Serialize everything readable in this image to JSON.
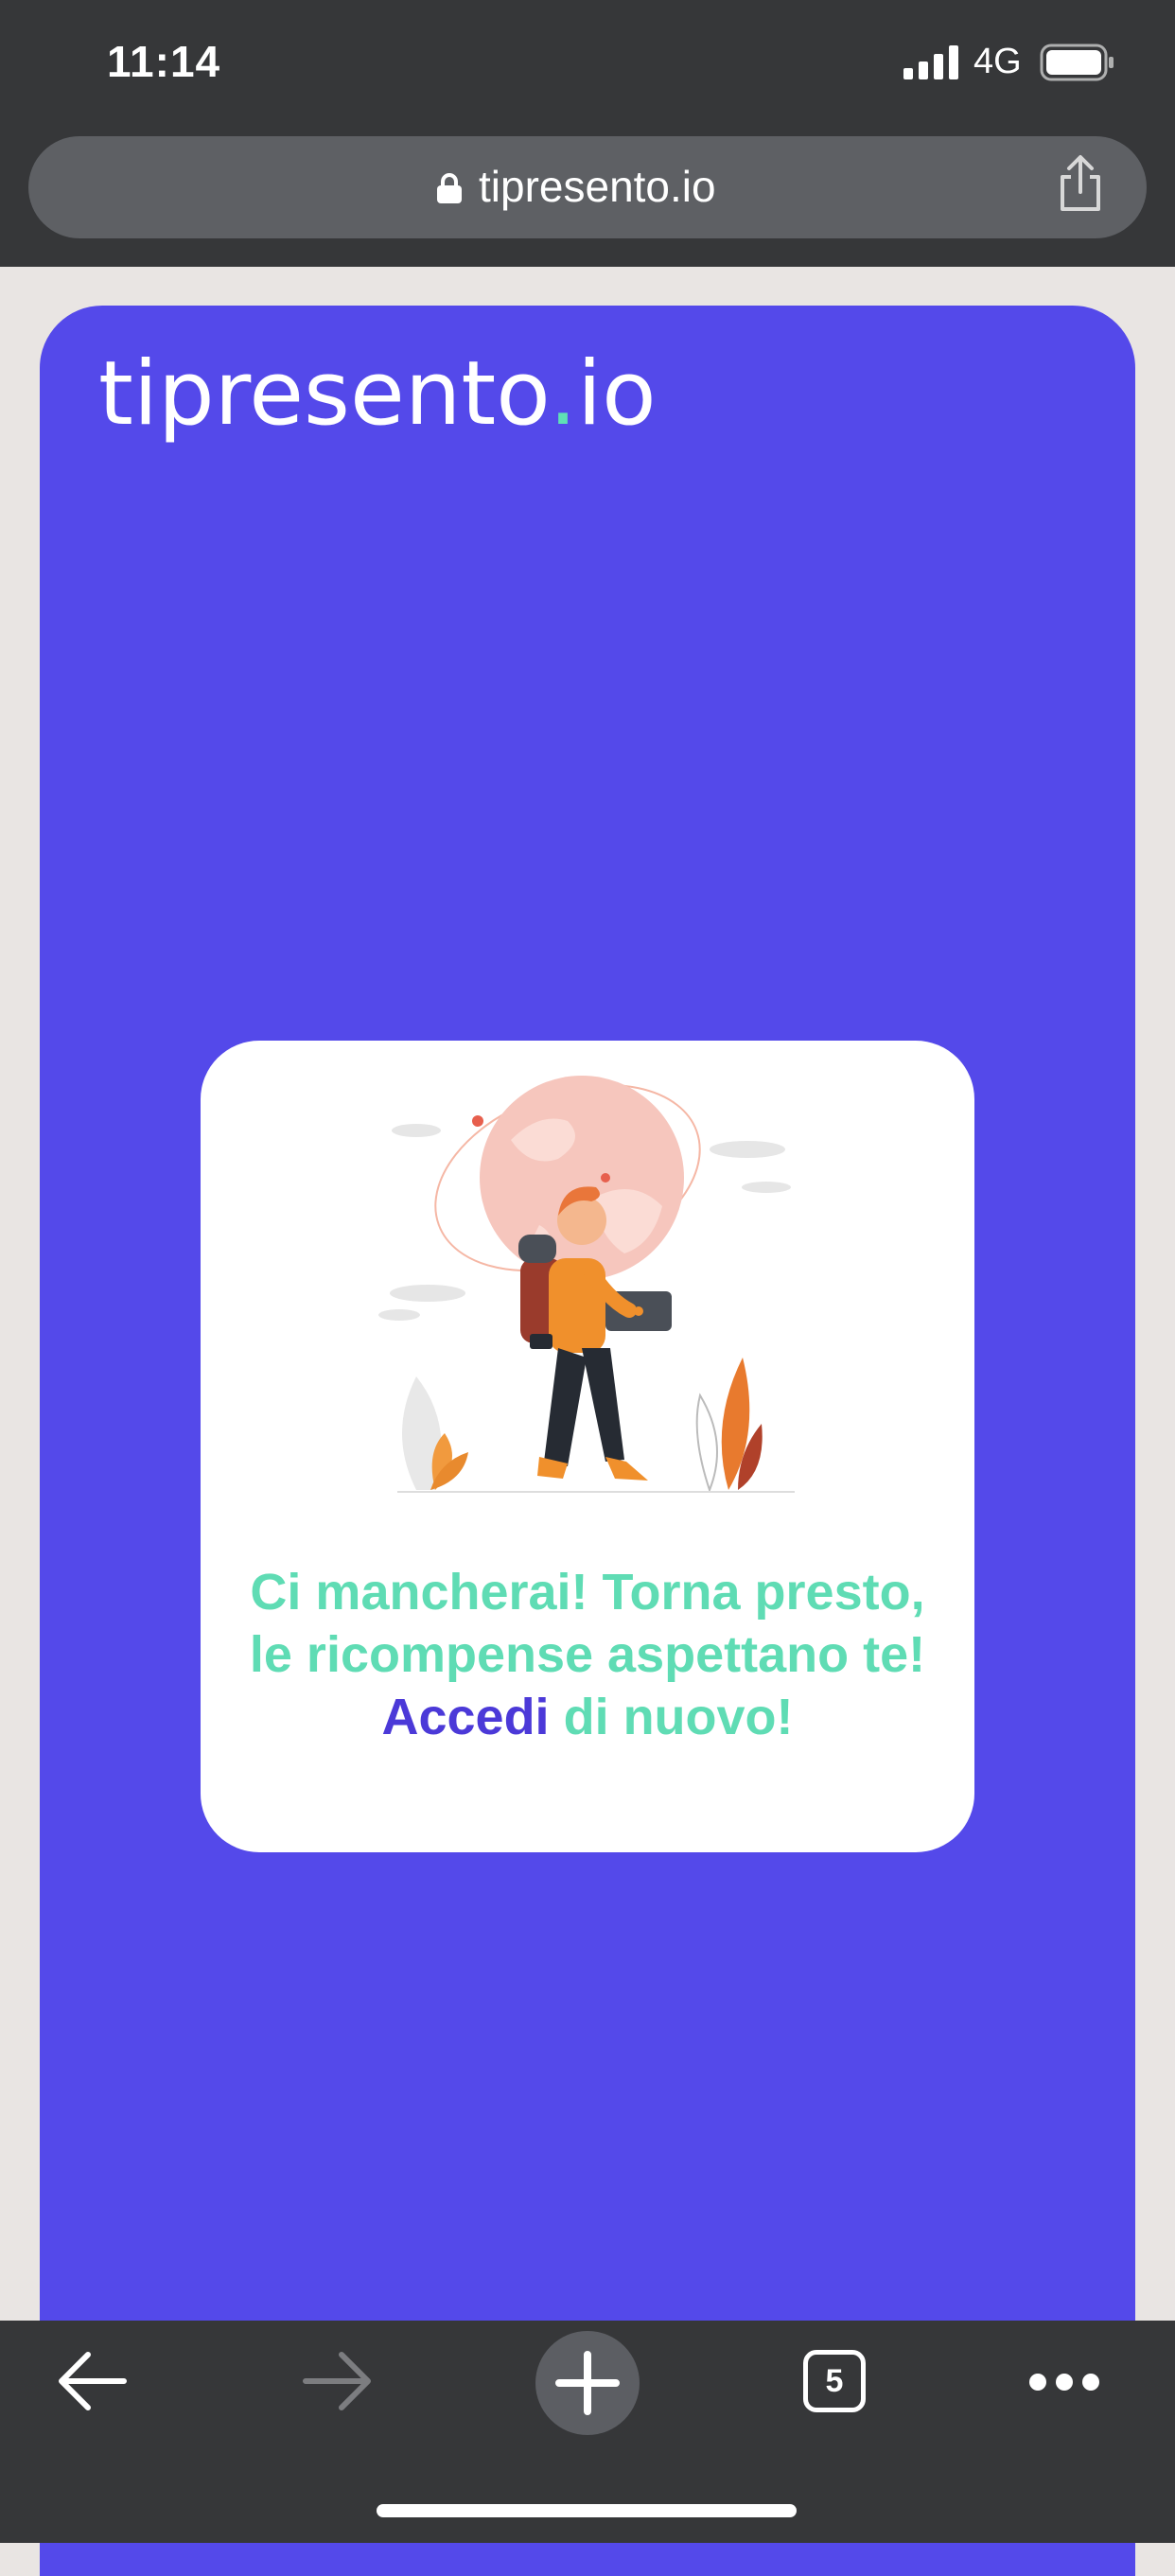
{
  "status_bar": {
    "time": "11:14",
    "network": "4G"
  },
  "browser": {
    "url": "tipresento.io",
    "tab_count": "5"
  },
  "site": {
    "logo_main": "tipresento",
    "logo_dot": ".",
    "logo_tld": "io"
  },
  "message": {
    "before_link": "Ci mancherai! Torna presto, le ricompense aspettano te!",
    "link": "Accedi",
    "after_link": "di nuovo!"
  },
  "colors": {
    "brand": "#5449ea",
    "accent": "#5fdcb4",
    "link": "#4b39d8",
    "chrome": "#363739"
  },
  "icons": [
    "signal-icon",
    "battery-icon",
    "lock-icon",
    "share-icon",
    "back-arrow-icon",
    "forward-arrow-icon",
    "plus-icon",
    "more-icon"
  ]
}
